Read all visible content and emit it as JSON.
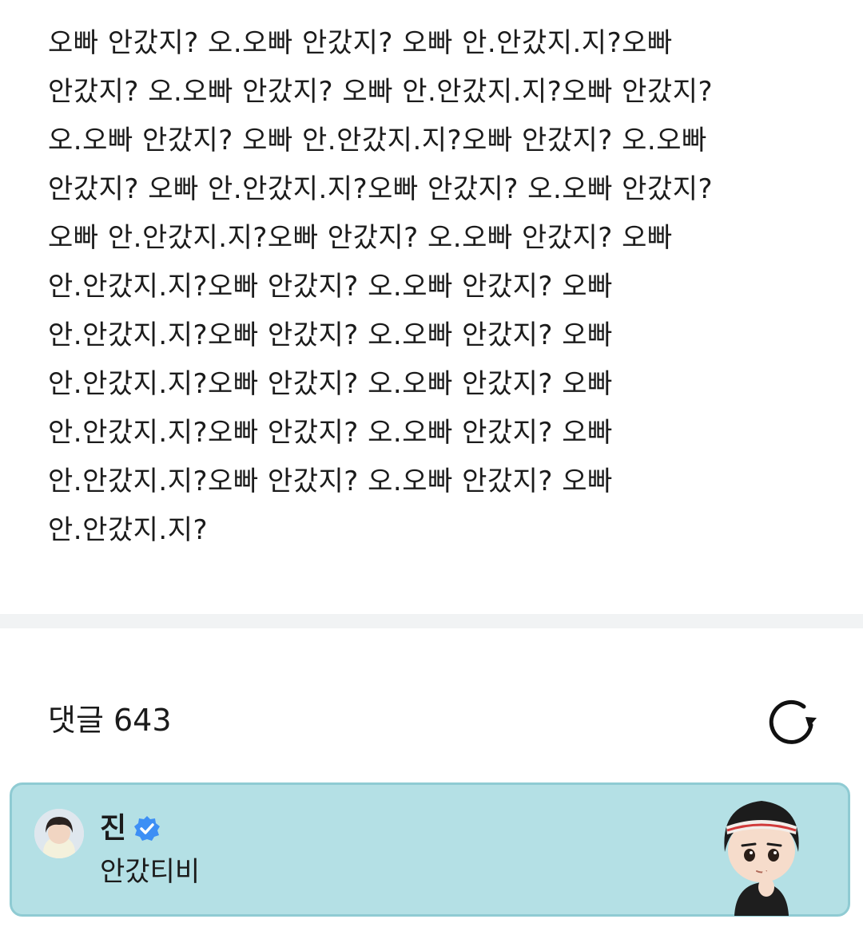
{
  "post": {
    "lines": [
      "오빠 안갔지? 오.오빠 안갔지? 오빠 안.안갔지.지?오빠",
      "안갔지? 오.오빠 안갔지? 오빠 안.안갔지.지?오빠 안갔지?",
      "오.오빠 안갔지? 오빠 안.안갔지.지?오빠 안갔지? 오.오빠",
      "안갔지? 오빠 안.안갔지.지?오빠 안갔지? 오.오빠 안갔지?",
      "오빠 안.안갔지.지?오빠 안갔지? 오.오빠 안갔지? 오빠",
      "안.안갔지.지?오빠 안갔지? 오.오빠 안갔지? 오빠",
      "안.안갔지.지?오빠 안갔지? 오.오빠 안갔지? 오빠",
      "안.안갔지.지?오빠 안갔지? 오.오빠 안갔지? 오빠",
      "안.안갔지.지?오빠 안갔지? 오.오빠 안갔지? 오빠",
      "안.안갔지.지?오빠 안갔지? 오.오빠 안갔지? 오빠",
      "안.안갔지.지?"
    ]
  },
  "comments": {
    "header_label": "댓글 643",
    "refresh_icon": "refresh-icon"
  },
  "comment": {
    "author": "진",
    "verified_icon": "verified-badge-icon",
    "text": "안갔티비",
    "sticker": "character-sticker",
    "colors": {
      "card_background": "#b4e0e5",
      "card_border": "#8fcbd3",
      "verified_blue": "#3d8ff5"
    }
  }
}
